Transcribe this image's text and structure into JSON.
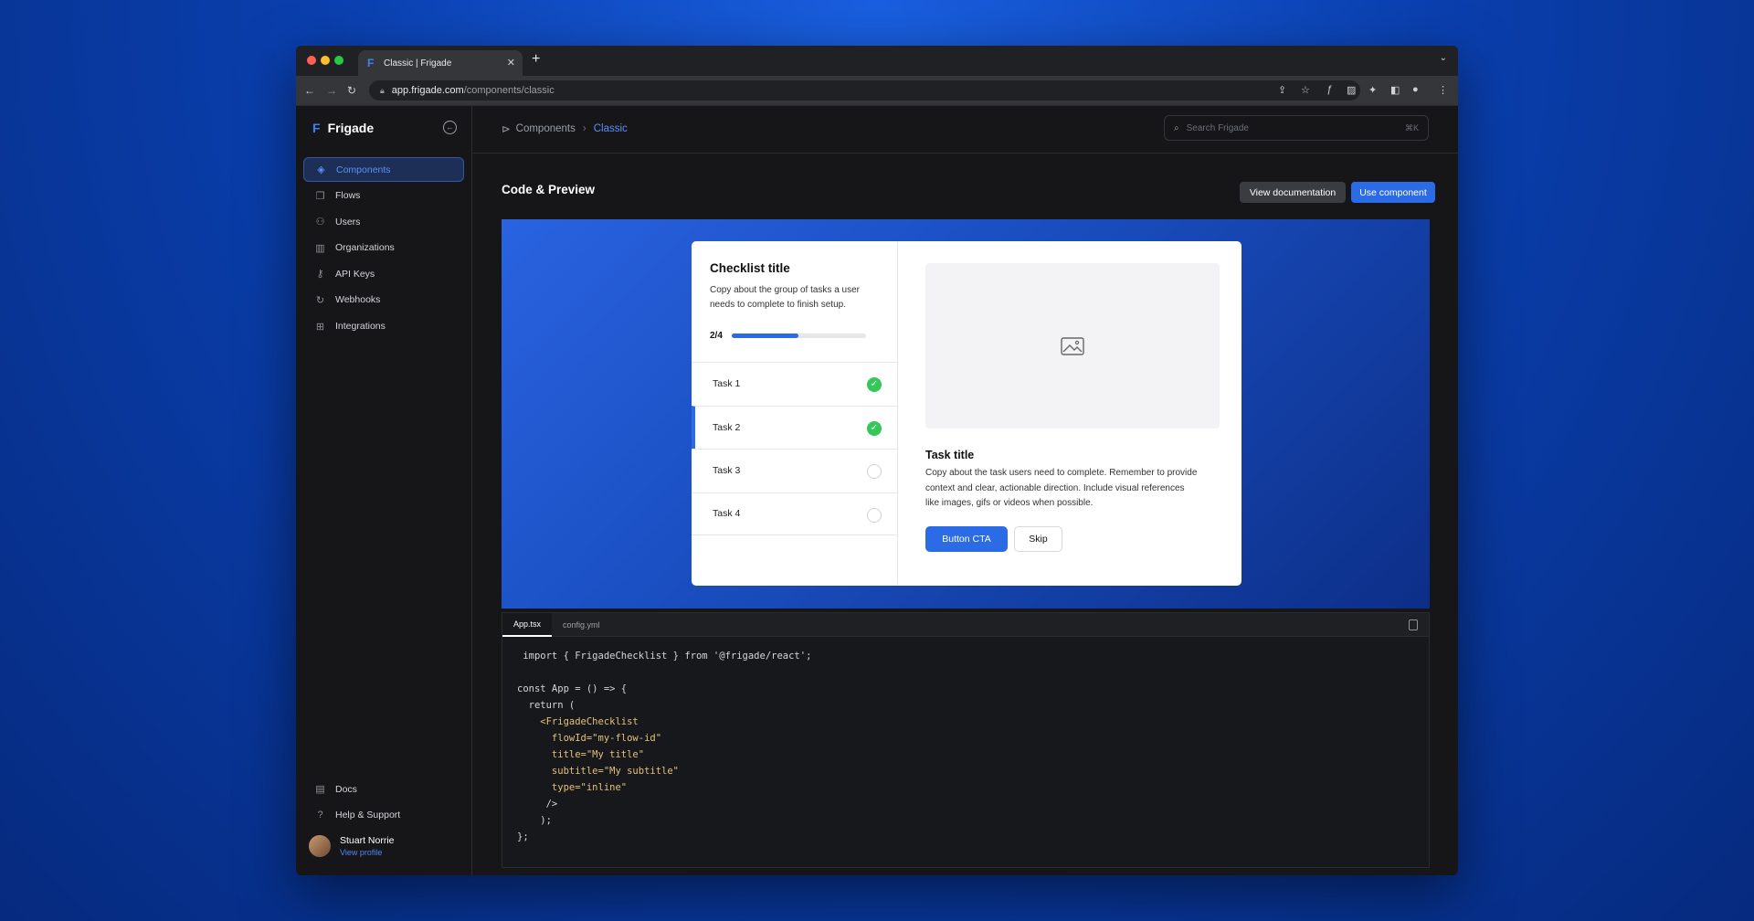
{
  "browser": {
    "tab_title": "Classic | Frigade",
    "url_host": "app.frigade.com",
    "url_path": "/components/classic"
  },
  "sidebar": {
    "brand": "Frigade",
    "items": [
      {
        "label": "Components",
        "icon": "layers-icon",
        "active": true
      },
      {
        "label": "Flows",
        "icon": "copy-icon"
      },
      {
        "label": "Users",
        "icon": "users-icon"
      },
      {
        "label": "Organizations",
        "icon": "building-icon"
      },
      {
        "label": "API Keys",
        "icon": "key-icon"
      },
      {
        "label": "Webhooks",
        "icon": "refresh-icon"
      },
      {
        "label": "Integrations",
        "icon": "grid-icon"
      }
    ],
    "bottom_items": [
      {
        "label": "Docs",
        "icon": "document-icon"
      },
      {
        "label": "Help & Support",
        "icon": "help-icon"
      }
    ],
    "user": {
      "name": "Stuart Norrie",
      "link": "View profile"
    }
  },
  "breadcrumb": {
    "parent": "Components",
    "current": "Classic"
  },
  "search": {
    "placeholder": "Search Frigade",
    "shortcut": "⌘K"
  },
  "section": {
    "title": "Code & Preview",
    "view_docs": "View documentation",
    "use_component": "Use component"
  },
  "checklist": {
    "title": "Checklist title",
    "subtitle": "Copy about the group of tasks a user needs to complete to finish setup.",
    "progress_label": "2/4",
    "progress_fraction": 0.5,
    "tasks": [
      {
        "label": "Task 1",
        "done": true
      },
      {
        "label": "Task 2",
        "done": true,
        "selected": true
      },
      {
        "label": "Task 3",
        "done": false
      },
      {
        "label": "Task 4",
        "done": false
      }
    ],
    "task_title": "Task title",
    "task_desc": "Copy about the task users need to complete. Remember to provide context and clear, actionable direction. Include visual references like images, gifs or videos when possible.",
    "cta": "Button CTA",
    "skip": "Skip"
  },
  "code": {
    "tabs": [
      "App.tsx",
      "config.yml"
    ],
    "active_tab": "App.tsx",
    "lines": [
      " import { FrigadeChecklist } from '@frigade/react';",
      "",
      "const App = () => {",
      "  return (",
      "    <FrigadeChecklist",
      "      flowId=\"my-flow-id\"",
      "      title=\"My title\"",
      "      subtitle=\"My subtitle\"",
      "      type=\"inline\"",
      "     />",
      "    );",
      "};"
    ]
  }
}
